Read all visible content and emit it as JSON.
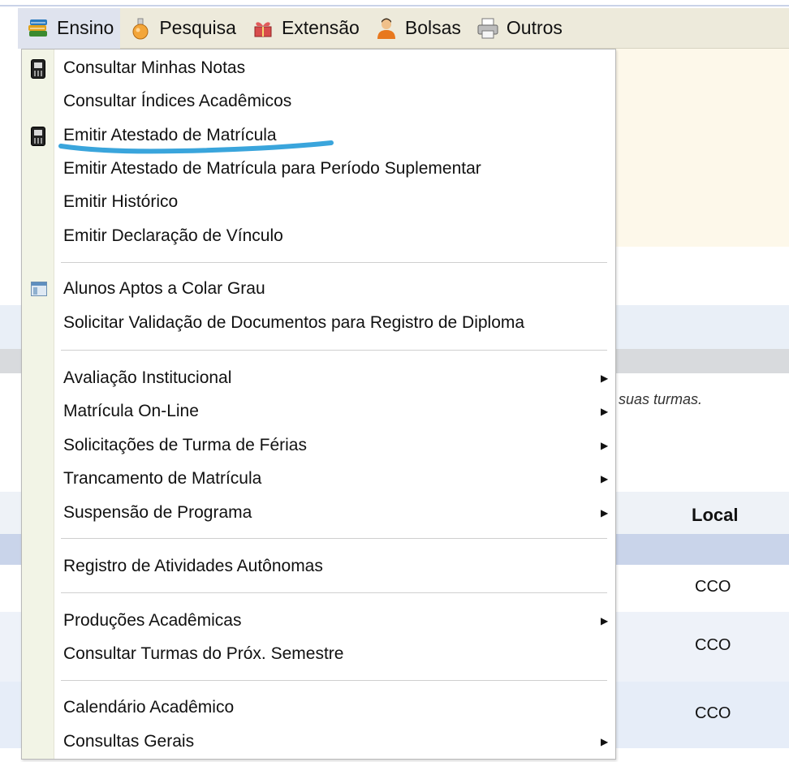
{
  "menubar": {
    "items": [
      {
        "label": "Ensino",
        "icon": "books-icon"
      },
      {
        "label": "Pesquisa",
        "icon": "flask-icon"
      },
      {
        "label": "Extensão",
        "icon": "heart-box-icon"
      },
      {
        "label": "Bolsas",
        "icon": "person-icon"
      },
      {
        "label": "Outros",
        "icon": "printer-icon"
      }
    ]
  },
  "dropdown": {
    "items": [
      {
        "label": "Consultar Minhas Notas",
        "icon": "phone-icon"
      },
      {
        "label": "Consultar Índices Acadêmicos"
      },
      {
        "label": "Emitir Atestado de Matrícula",
        "icon": "phone-icon"
      },
      {
        "label": "Emitir Atestado de Matrícula para Período Suplementar"
      },
      {
        "label": "Emitir Histórico"
      },
      {
        "label": "Emitir Declaração de Vínculo"
      },
      {
        "label": "Alunos Aptos a Colar Grau",
        "icon": "window-icon"
      },
      {
        "label": "Solicitar Validação de Documentos para Registro de Diploma"
      },
      {
        "label": "Avaliação Institucional",
        "submenu": true
      },
      {
        "label": "Matrícula On-Line",
        "submenu": true
      },
      {
        "label": "Solicitações de Turma de Férias",
        "submenu": true
      },
      {
        "label": "Trancamento de Matrícula",
        "submenu": true
      },
      {
        "label": "Suspensão de Programa",
        "submenu": true
      },
      {
        "label": "Registro de Atividades Autônomas"
      },
      {
        "label": "Produções Acadêmicas",
        "submenu": true
      },
      {
        "label": "Consultar Turmas do Próx. Semestre"
      },
      {
        "label": "Calendário Acadêmico"
      },
      {
        "label": "Consultas Gerais",
        "submenu": true
      }
    ],
    "arrow": "▶"
  },
  "background": {
    "note": "suas turmas.",
    "table_header_local": "Local",
    "rows": [
      "CCO",
      "CCO",
      "CCO"
    ]
  },
  "colors": {
    "menubar_bg": "#edeadb",
    "active_menu_bg": "#dfe3ee",
    "marker": "#3aa5dc"
  }
}
